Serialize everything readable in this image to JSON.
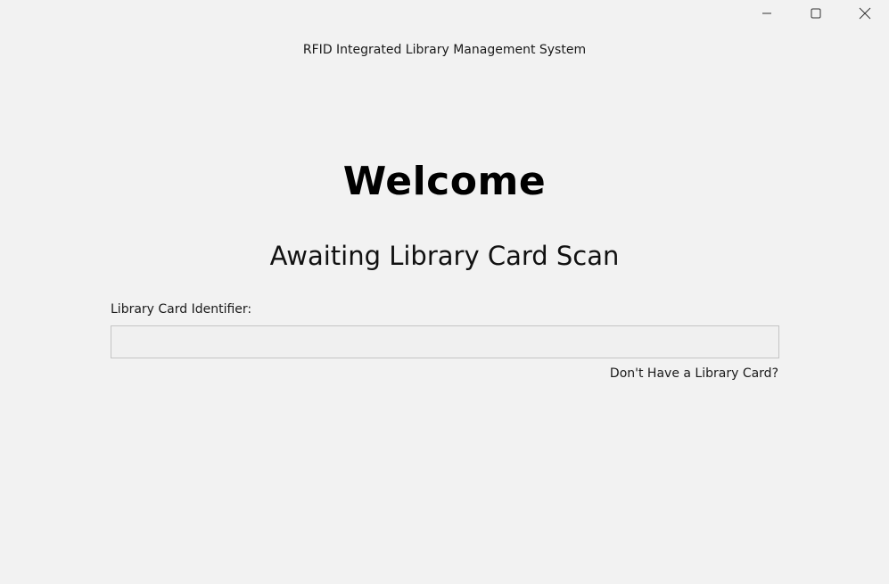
{
  "window": {
    "title": "RFID Integrated Library Management System",
    "controls": {
      "minimize_icon": "minimize-icon",
      "maximize_icon": "maximize-icon",
      "close_icon": "close-icon"
    }
  },
  "main": {
    "heading": "Welcome",
    "subheading": "Awaiting Library Card Scan",
    "card_field": {
      "label": "Library Card Identifier:",
      "value": "",
      "placeholder": ""
    },
    "no_card_link": "Don't Have a Library Card?"
  },
  "colors": {
    "background": "#f2f2f2",
    "text": "#1a1a1a",
    "input_border": "#c4c4c4"
  }
}
